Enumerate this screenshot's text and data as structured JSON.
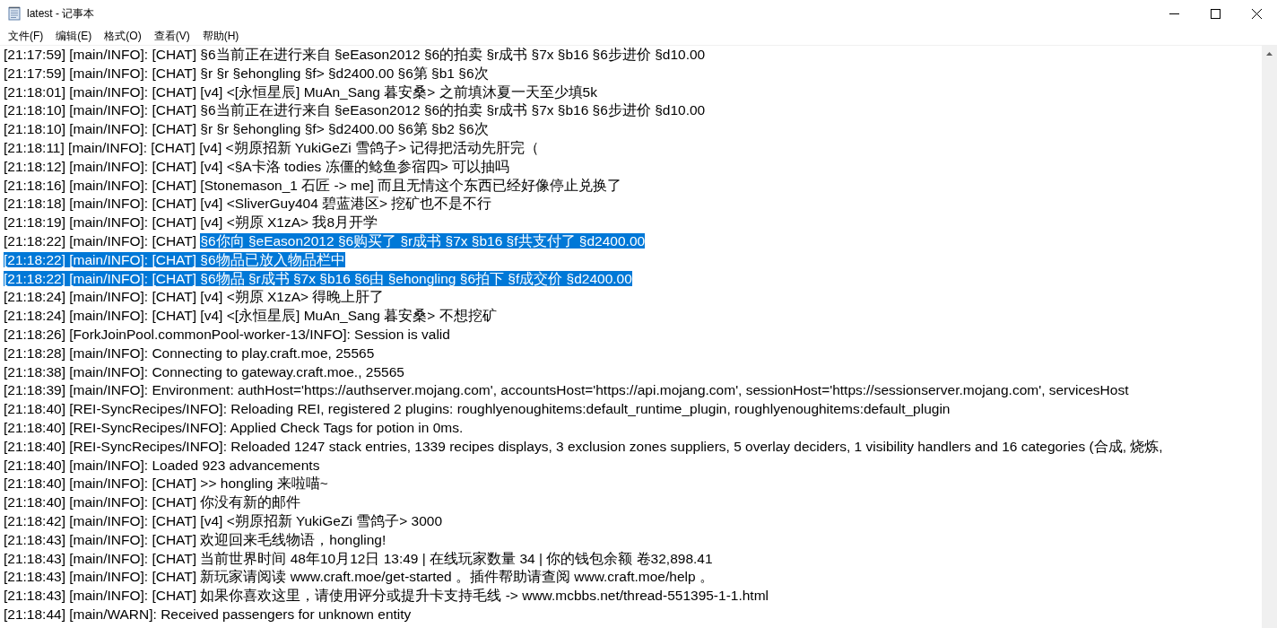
{
  "window": {
    "title": "latest - 记事本",
    "controls": [
      {
        "kind": "minimize"
      },
      {
        "kind": "maximize"
      },
      {
        "kind": "close"
      }
    ]
  },
  "menu": [
    "文件(F)",
    "编辑(E)",
    "格式(O)",
    "查看(V)",
    "帮助(H)"
  ],
  "lines": [
    {
      "segments": [
        {
          "text": "[21:17:59] [main/INFO]: [CHAT] §6当前正在进行来自 §eEason2012 §6的拍卖 §r成书 §7x §b16 §6步进价 §d10.00",
          "selected": false
        }
      ]
    },
    {
      "segments": [
        {
          "text": "[21:17:59] [main/INFO]: [CHAT] §r §r §ehongling §f> §d2400.00 §6第 §b1 §6次",
          "selected": false
        }
      ]
    },
    {
      "segments": [
        {
          "text": "[21:18:01] [main/INFO]: [CHAT] [v4] <[永恒星辰] MuAn_Sang 暮安桑> 之前填沐夏一天至少填5k",
          "selected": false
        }
      ]
    },
    {
      "segments": [
        {
          "text": "[21:18:10] [main/INFO]: [CHAT] §6当前正在进行来自 §eEason2012 §6的拍卖 §r成书 §7x §b16 §6步进价 §d10.00",
          "selected": false
        }
      ]
    },
    {
      "segments": [
        {
          "text": "[21:18:10] [main/INFO]: [CHAT] §r §r §ehongling §f> §d2400.00 §6第 §b2 §6次",
          "selected": false
        }
      ]
    },
    {
      "segments": [
        {
          "text": "[21:18:11] [main/INFO]: [CHAT] [v4] <朔原招新 YukiGeZi 雪鸽子> 记得把活动先肝完（",
          "selected": false
        }
      ]
    },
    {
      "segments": [
        {
          "text": "[21:18:12] [main/INFO]: [CHAT] [v4] <§A卡洛 todies 冻僵的鲶鱼参宿四> 可以抽吗",
          "selected": false
        }
      ]
    },
    {
      "segments": [
        {
          "text": "[21:18:16] [main/INFO]: [CHAT] [Stonemason_1 石匠 -> me] 而且无情这个东西已经好像停止兑换了",
          "selected": false
        }
      ]
    },
    {
      "segments": [
        {
          "text": "[21:18:18] [main/INFO]: [CHAT] [v4] <SliverGuy404 碧蓝港区> 挖矿也不是不行",
          "selected": false
        }
      ]
    },
    {
      "segments": [
        {
          "text": "[21:18:19] [main/INFO]: [CHAT] [v4] <朔原 X1zA> 我8月开学",
          "selected": false
        }
      ]
    },
    {
      "segments": [
        {
          "text": "[21:18:22] [main/INFO]: [CHAT] ",
          "selected": false
        },
        {
          "text": "§6你向 §eEason2012 §6购买了 §r成书 §7x §b16 §f共支付了 §d2400.00",
          "selected": true
        }
      ]
    },
    {
      "segments": [
        {
          "text": "[21:18:22] [main/INFO]: [CHAT] §6物品已放入物品栏中",
          "selected": true
        }
      ]
    },
    {
      "segments": [
        {
          "text": "[21:18:22] [main/INFO]: [CHAT] §6物品 §r成书 §7x §b16 §6由 §ehongling §6拍下 §f成交价 §d2400.00",
          "selected": true
        }
      ]
    },
    {
      "segments": [
        {
          "text": "[21:18:24] [main/INFO]: [CHAT] [v4] <朔原 X1zA> 得晚上肝了",
          "selected": false
        }
      ]
    },
    {
      "segments": [
        {
          "text": "[21:18:24] [main/INFO]: [CHAT] [v4] <[永恒星辰] MuAn_Sang 暮安桑> 不想挖矿",
          "selected": false
        }
      ]
    },
    {
      "segments": [
        {
          "text": "[21:18:26] [ForkJoinPool.commonPool-worker-13/INFO]: Session is valid",
          "selected": false
        }
      ]
    },
    {
      "segments": [
        {
          "text": "[21:18:28] [main/INFO]: Connecting to play.craft.moe, 25565",
          "selected": false
        }
      ]
    },
    {
      "segments": [
        {
          "text": "[21:18:38] [main/INFO]: Connecting to gateway.craft.moe., 25565",
          "selected": false
        }
      ]
    },
    {
      "segments": [
        {
          "text": "[21:18:39] [main/INFO]: Environment: authHost='https://authserver.mojang.com', accountsHost='https://api.mojang.com', sessionHost='https://sessionserver.mojang.com', servicesHost",
          "selected": false
        }
      ]
    },
    {
      "segments": [
        {
          "text": "[21:18:40] [REI-SyncRecipes/INFO]: Reloading REI, registered 2 plugins: roughlyenoughitems:default_runtime_plugin, roughlyenoughitems:default_plugin",
          "selected": false
        }
      ]
    },
    {
      "segments": [
        {
          "text": "[21:18:40] [REI-SyncRecipes/INFO]: Applied Check Tags for potion in 0ms.",
          "selected": false
        }
      ]
    },
    {
      "segments": [
        {
          "text": "[21:18:40] [REI-SyncRecipes/INFO]: Reloaded 1247 stack entries, 1339 recipes displays, 3 exclusion zones suppliers, 5 overlay deciders, 1 visibility handlers and 16 categories (合成, 烧炼,",
          "selected": false
        }
      ]
    },
    {
      "segments": [
        {
          "text": "[21:18:40] [main/INFO]: Loaded 923 advancements",
          "selected": false
        }
      ]
    },
    {
      "segments": [
        {
          "text": "[21:18:40] [main/INFO]: [CHAT] >> hongling 来啦喵~",
          "selected": false
        }
      ]
    },
    {
      "segments": [
        {
          "text": "[21:18:40] [main/INFO]: [CHAT] 你没有新的邮件",
          "selected": false
        }
      ]
    },
    {
      "segments": [
        {
          "text": "[21:18:42] [main/INFO]: [CHAT] [v4] <朔原招新 YukiGeZi 雪鸽子> 3000",
          "selected": false
        }
      ]
    },
    {
      "segments": [
        {
          "text": "[21:18:43] [main/INFO]: [CHAT] 欢迎回来毛线物语，hongling!",
          "selected": false
        }
      ]
    },
    {
      "segments": [
        {
          "text": "[21:18:43] [main/INFO]: [CHAT] 当前世界时间 48年10月12日 13:49 | 在线玩家数量 34 | 你的钱包余额 卷32,898.41",
          "selected": false
        }
      ]
    },
    {
      "segments": [
        {
          "text": "[21:18:43] [main/INFO]: [CHAT] 新玩家请阅读 www.craft.moe/get-started 。插件帮助请查阅 www.craft.moe/help 。",
          "selected": false
        }
      ]
    },
    {
      "segments": [
        {
          "text": "[21:18:43] [main/INFO]: [CHAT] 如果你喜欢这里，请使用评分或提升卡支持毛线 -> www.mcbbs.net/thread-551395-1-1.html",
          "selected": false
        }
      ]
    },
    {
      "segments": [
        {
          "text": "[21:18:44] [main/WARN]: Received passengers for unknown entity",
          "selected": false
        }
      ]
    }
  ]
}
